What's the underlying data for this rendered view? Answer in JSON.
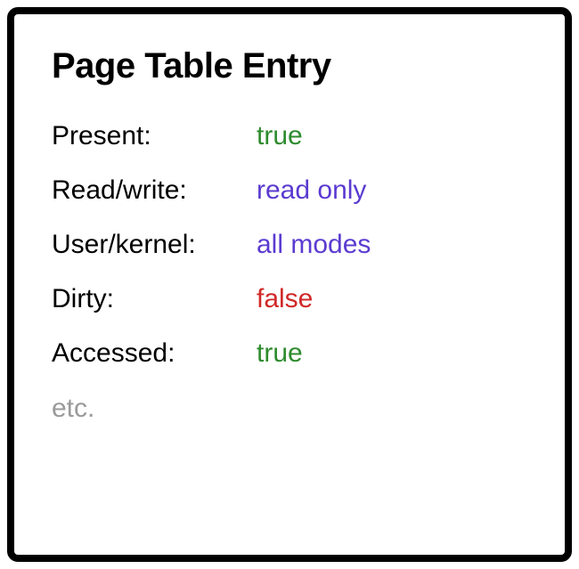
{
  "title": "Page Table Entry",
  "entries": [
    {
      "label": "Present:",
      "value": "true",
      "colorClass": "color-green"
    },
    {
      "label": "Read/write:",
      "value": "read only",
      "colorClass": "color-purple"
    },
    {
      "label": "User/kernel:",
      "value": "all modes",
      "colorClass": "color-purple"
    },
    {
      "label": "Dirty:",
      "value": "false",
      "colorClass": "color-red"
    },
    {
      "label": "Accessed:",
      "value": "true",
      "colorClass": "color-green"
    }
  ],
  "etc": "etc."
}
